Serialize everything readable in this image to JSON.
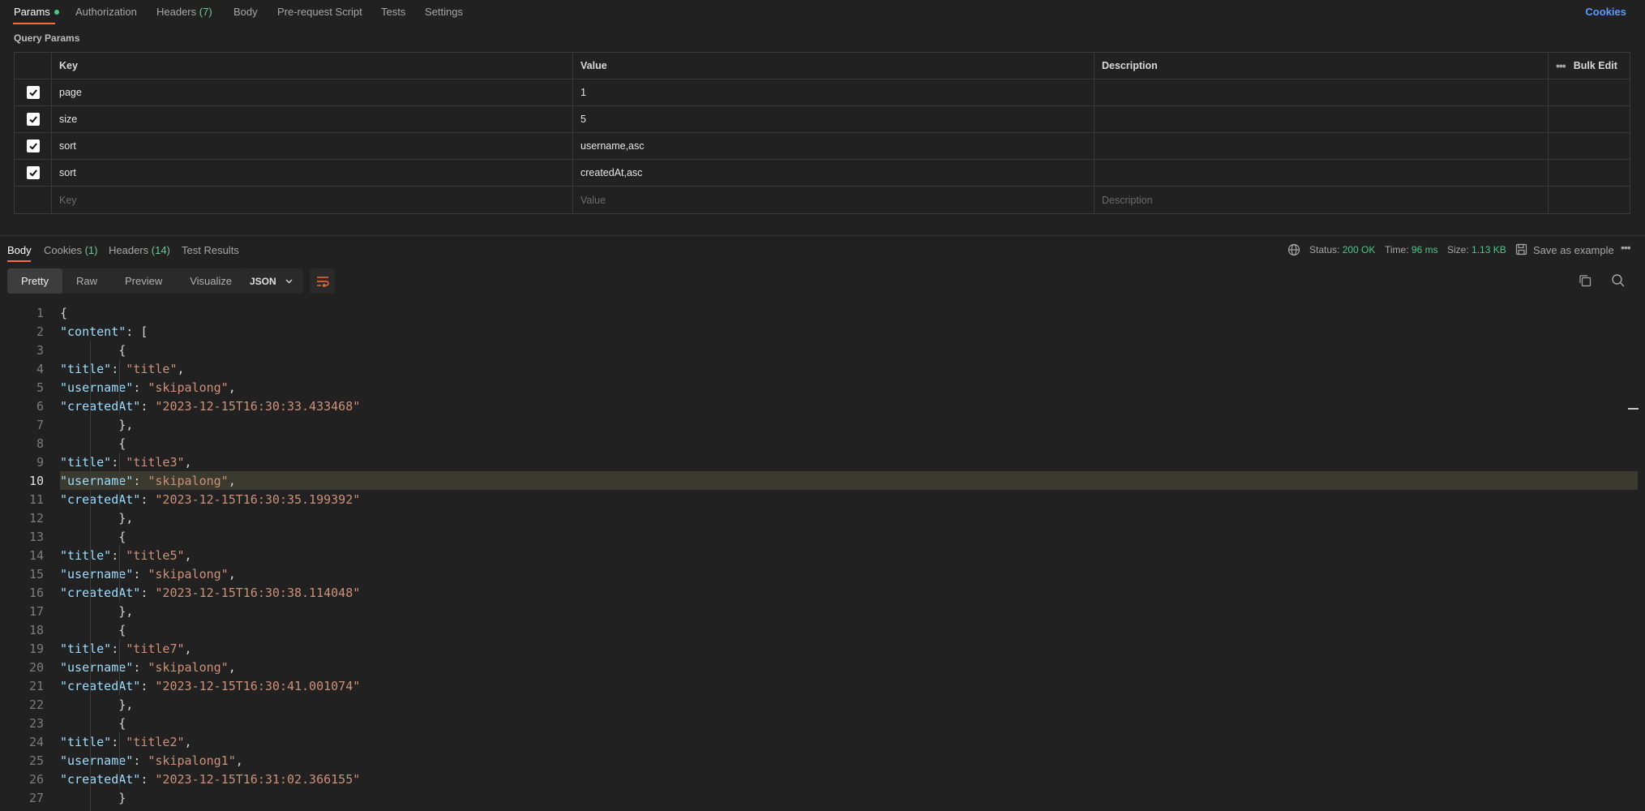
{
  "request": {
    "tabs": [
      {
        "label": "Params",
        "active": true,
        "dot": true
      },
      {
        "label": "Authorization"
      },
      {
        "label": "Headers",
        "count": "(7)"
      },
      {
        "label": "Body"
      },
      {
        "label": "Pre-request Script"
      },
      {
        "label": "Tests"
      },
      {
        "label": "Settings"
      }
    ],
    "cookies_link": "Cookies"
  },
  "query_params": {
    "section_label": "Query Params",
    "headers": {
      "key": "Key",
      "value": "Value",
      "description": "Description",
      "bulk_edit": "Bulk Edit"
    },
    "rows": [
      {
        "checked": true,
        "key": "page",
        "value": "1",
        "description": ""
      },
      {
        "checked": true,
        "key": "size",
        "value": "5",
        "description": ""
      },
      {
        "checked": true,
        "key": "sort",
        "value": "username,asc",
        "description": ""
      },
      {
        "checked": true,
        "key": "sort",
        "value": "createdAt,asc",
        "description": ""
      }
    ],
    "placeholders": {
      "key": "Key",
      "value": "Value",
      "description": "Description"
    }
  },
  "response": {
    "tabs": [
      {
        "label": "Body",
        "active": true
      },
      {
        "label": "Cookies",
        "count": "(1)"
      },
      {
        "label": "Headers",
        "count": "(14)"
      },
      {
        "label": "Test Results"
      }
    ],
    "status_label": "Status:",
    "status_value": "200 OK",
    "time_label": "Time:",
    "time_value": "96 ms",
    "size_label": "Size:",
    "size_value": "1.13 KB",
    "save_example": "Save as example",
    "views": [
      "Pretty",
      "Raw",
      "Preview",
      "Visualize"
    ],
    "active_view": "Pretty",
    "format": "JSON"
  },
  "editor": {
    "highlighted_line": 10,
    "lines": [
      "{",
      "    \"content\": [",
      "        {",
      "            \"title\": \"title\",",
      "            \"username\": \"skipalong\",",
      "            \"createdAt\": \"2023-12-15T16:30:33.433468\"",
      "        },",
      "        {",
      "            \"title\": \"title3\",",
      "            \"username\": \"skipalong\",",
      "            \"createdAt\": \"2023-12-15T16:30:35.199392\"",
      "        },",
      "        {",
      "            \"title\": \"title5\",",
      "            \"username\": \"skipalong\",",
      "            \"createdAt\": \"2023-12-15T16:30:38.114048\"",
      "        },",
      "        {",
      "            \"title\": \"title7\",",
      "            \"username\": \"skipalong\",",
      "            \"createdAt\": \"2023-12-15T16:30:41.001074\"",
      "        },",
      "        {",
      "            \"title\": \"title2\",",
      "            \"username\": \"skipalong1\",",
      "            \"createdAt\": \"2023-12-15T16:31:02.366155\"",
      "        }",
      "    ],"
    ]
  },
  "colors": {
    "accent": "#ff6c37",
    "success": "#49c98b",
    "link": "#5c9bff",
    "json_key": "#9cdcfe",
    "json_string": "#ce9178"
  }
}
